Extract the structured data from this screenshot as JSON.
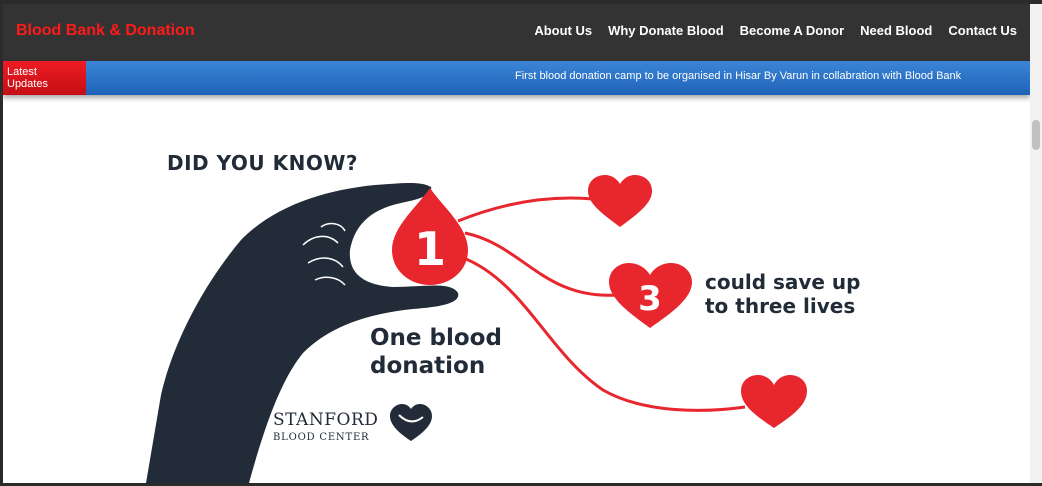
{
  "header": {
    "brand": "Blood Bank & Donation",
    "nav": [
      {
        "label": "About Us"
      },
      {
        "label": "Why Donate Blood"
      },
      {
        "label": "Become A Donor"
      },
      {
        "label": "Need Blood"
      },
      {
        "label": "Contact Us"
      }
    ]
  },
  "updates": {
    "label_line1": "Latest",
    "label_line2": "Updates",
    "text": "First blood donation camp to be organised in Hisar By Varun in collabration with Blood Bank"
  },
  "infographic": {
    "heading": "DID YOU KNOW?",
    "drop_number": "1",
    "heart_number": "3",
    "caption_line1": "One blood",
    "caption_line2": "donation",
    "side_line1": "could save up",
    "side_line2": "to three lives",
    "logo_line1": "STANFORD",
    "logo_line2": "BLOOD CENTER"
  },
  "colors": {
    "nav_bg": "#333333",
    "brand": "#ff1a1a",
    "updates_bar": "#2a72c8",
    "updates_label": "#e31b23",
    "blood_red": "#e8262d",
    "navy": "#222b38"
  }
}
